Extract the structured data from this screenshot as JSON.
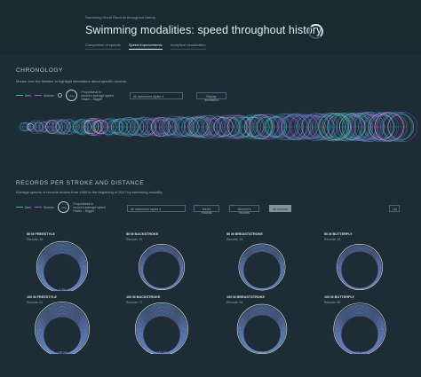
{
  "header": {
    "supertitle": "Swimming World Records throughout history",
    "title": "Swimming modalities: speed throughout history",
    "tabs": [
      {
        "label": "Competition of speeds",
        "active": false
      },
      {
        "label": "Speed improvements",
        "active": true
      },
      {
        "label": "Analytical visualization",
        "active": false
      }
    ]
  },
  "chronology": {
    "title": "CHRONOLOGY",
    "hint": "Mouse over the timeline to highlight information about specific records.",
    "legend": {
      "men": "Men",
      "women": "Women",
      "circle_label": "Avg",
      "size_text_1": "Proportional to",
      "size_text_2": "record's average speed",
      "faster": "Faster",
      "bigger": "Bigger"
    },
    "select_value": "All swimmers styles",
    "replay_label": "Replay animation"
  },
  "records": {
    "title": "RECORDS PER STROKE AND DISTANCE",
    "hint": "Average speeds of records broken from 1960 to the beginning of 2017 by swimming modality",
    "legend": {
      "men": "Men",
      "women": "Women",
      "circle_label": "Avg",
      "size_text_1": "Proportional to",
      "size_text_2": "record's average speed",
      "faster": "Faster",
      "bigger": "Bigger"
    },
    "select_value": "All swimmers styles",
    "filters": [
      {
        "label": "Men's records",
        "active": false
      },
      {
        "label": "Women's records",
        "active": false
      },
      {
        "label": "All records",
        "active": true
      }
    ],
    "up_label": "Up",
    "panels": [
      {
        "title": "50 M FREESTYLE",
        "count": "Records: 46",
        "rings": 16,
        "scale": "1 m/s"
      },
      {
        "title": "50 M BACKSTROKE",
        "count": "Records: 15",
        "rings": 9,
        "scale": "1 m/s"
      },
      {
        "title": "50 M BREASTSTROKE",
        "count": "Records: 18",
        "rings": 10,
        "scale": "1 m/s"
      },
      {
        "title": "50 M BUTTERFLY",
        "count": "Records: 16",
        "rings": 9,
        "scale": "1 m/s"
      },
      {
        "title": "100 M FREESTYLE",
        "count": "Records: 61",
        "rings": 20,
        "scale": "1.90 m/s"
      },
      {
        "title": "100 M BACKSTROKE",
        "count": "Records: 72",
        "rings": 18,
        "scale": "1.50 m/s"
      },
      {
        "title": "100 M BREASTSTROKE",
        "count": "Records: 49",
        "rings": 14,
        "scale": "1.40 m/s"
      },
      {
        "title": "100 M BUTTERFLY",
        "count": "Records: 58",
        "rings": 17,
        "scale": "1.70 m/s"
      }
    ]
  },
  "colors": {
    "men": "#36b5c4",
    "women": "#a35bd6",
    "ring_light": "#e8eef1"
  }
}
